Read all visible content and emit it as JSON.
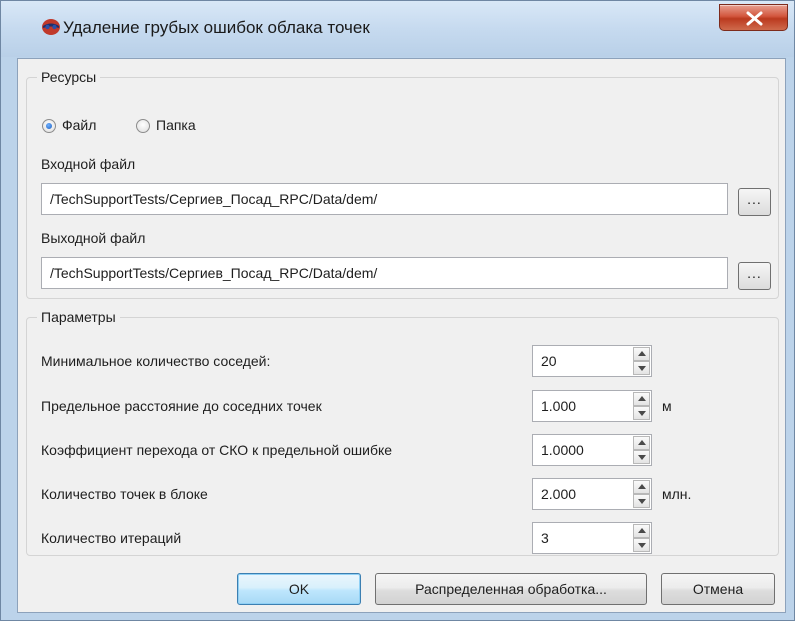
{
  "window": {
    "title": "Удаление грубых ошибок облака точек",
    "close_label": "X"
  },
  "resources": {
    "group_title": "Ресурсы",
    "source_options": [
      {
        "label": "Файл",
        "checked": true
      },
      {
        "label": "Папка",
        "checked": false
      }
    ],
    "input_file": {
      "label": "Входной файл",
      "value": "/TechSupportTests/Сергиев_Посад_RPC/Data/dem/",
      "browse_label": "..."
    },
    "output_file": {
      "label": "Выходной файл",
      "value": "/TechSupportTests/Сергиев_Посад_RPC/Data/dem/",
      "browse_label": "..."
    }
  },
  "parameters": {
    "group_title": "Параметры",
    "rows": [
      {
        "label": "Минимальное количество соседей:",
        "value": "20",
        "unit": ""
      },
      {
        "label": "Предельное расстояние до соседних точек",
        "value": "1.000",
        "unit": "м"
      },
      {
        "label": "Коэффициент перехода от СКО к предельной ошибке",
        "value": "1.0000",
        "unit": ""
      },
      {
        "label": "Количество точек в блоке",
        "value": "2.000",
        "unit": "млн."
      },
      {
        "label": "Количество итераций",
        "value": "3",
        "unit": ""
      }
    ]
  },
  "buttons": {
    "ok": "OK",
    "distributed": "Распределенная обработка...",
    "cancel": "Отмена"
  },
  "colors": {
    "title_bar": "#c6daef",
    "close_button": "#c8442a",
    "client_background": "#f0f0f0",
    "default_button_border": "#3c7fb1"
  }
}
